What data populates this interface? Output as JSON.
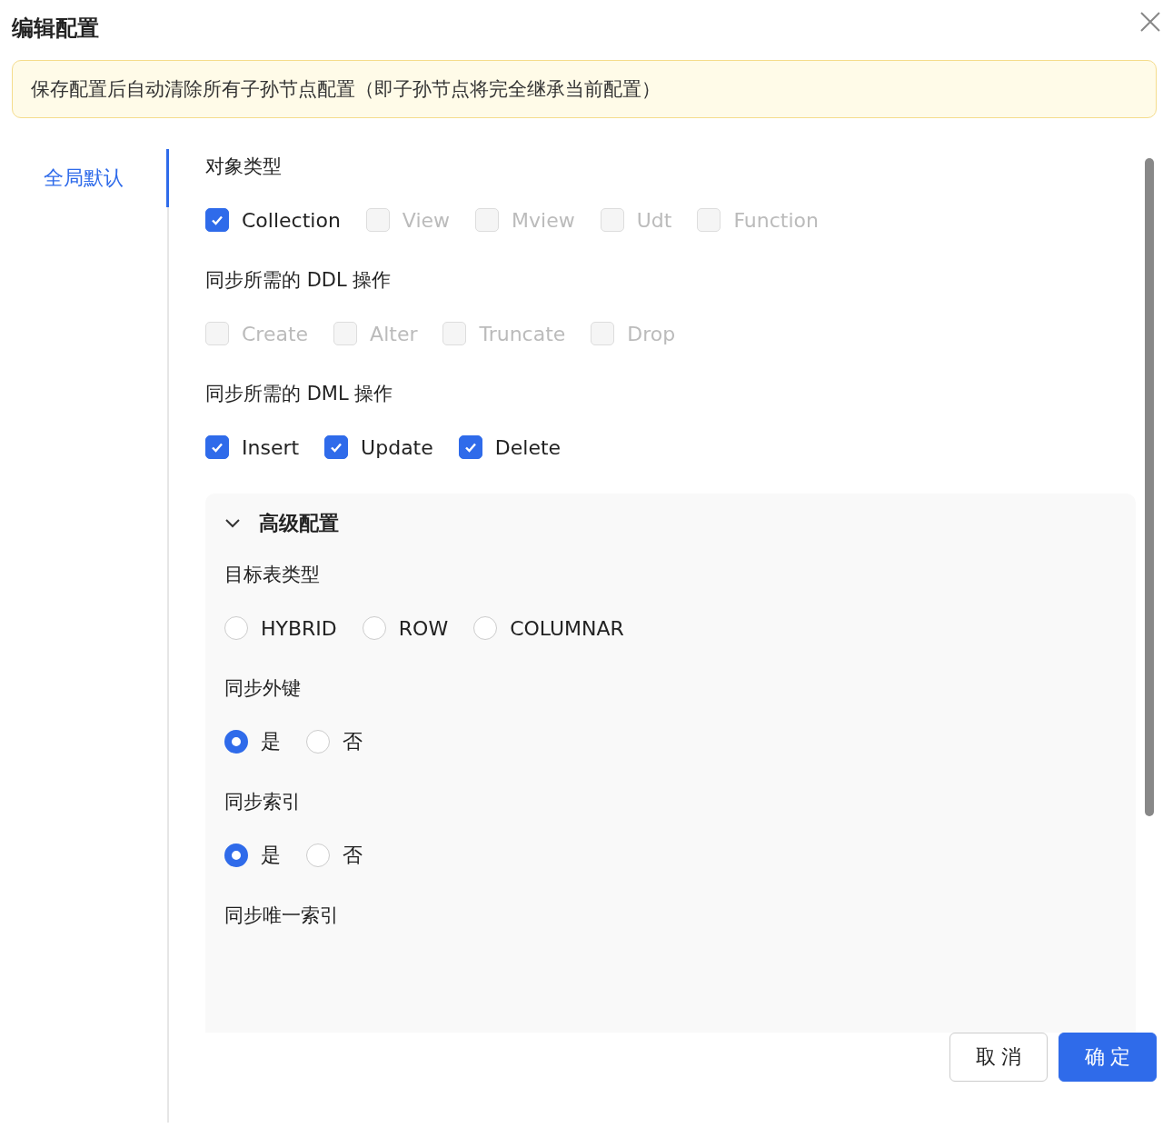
{
  "dialog": {
    "title": "编辑配置"
  },
  "notice": "保存配置后自动清除所有子孙节点配置（即子孙节点将完全继承当前配置）",
  "sidebar": {
    "items": [
      {
        "label": "全局默认",
        "selected": true
      }
    ]
  },
  "sections": [
    {
      "label": "对象类型",
      "options": [
        {
          "label": "Collection",
          "checked": true,
          "disabled": false
        },
        {
          "label": "View",
          "checked": false,
          "disabled": true
        },
        {
          "label": "Mview",
          "checked": false,
          "disabled": true
        },
        {
          "label": "Udt",
          "checked": false,
          "disabled": true
        },
        {
          "label": "Function",
          "checked": false,
          "disabled": true
        }
      ]
    },
    {
      "label": "同步所需的 DDL 操作",
      "options": [
        {
          "label": "Create",
          "checked": false,
          "disabled": true
        },
        {
          "label": "Alter",
          "checked": false,
          "disabled": true
        },
        {
          "label": "Truncate",
          "checked": false,
          "disabled": true
        },
        {
          "label": "Drop",
          "checked": false,
          "disabled": true
        }
      ]
    },
    {
      "label": "同步所需的 DML 操作",
      "options": [
        {
          "label": "Insert",
          "checked": true,
          "disabled": false
        },
        {
          "label": "Update",
          "checked": true,
          "disabled": false
        },
        {
          "label": "Delete",
          "checked": true,
          "disabled": false
        }
      ]
    }
  ],
  "advanced": {
    "title": "高级配置",
    "expanded": true,
    "groups": [
      {
        "label": "目标表类型",
        "options": [
          {
            "label": "HYBRID",
            "selected": false
          },
          {
            "label": "ROW",
            "selected": false
          },
          {
            "label": "COLUMNAR",
            "selected": false
          }
        ]
      },
      {
        "label": "同步外键",
        "options": [
          {
            "label": "是",
            "selected": true
          },
          {
            "label": "否",
            "selected": false
          }
        ]
      },
      {
        "label": "同步索引",
        "options": [
          {
            "label": "是",
            "selected": true
          },
          {
            "label": "否",
            "selected": false
          }
        ]
      },
      {
        "label": "同步唯一索引"
      }
    ]
  },
  "buttons": [
    {
      "label": "取 消",
      "kind": "default"
    },
    {
      "label": "确 定",
      "kind": "primary"
    }
  ]
}
